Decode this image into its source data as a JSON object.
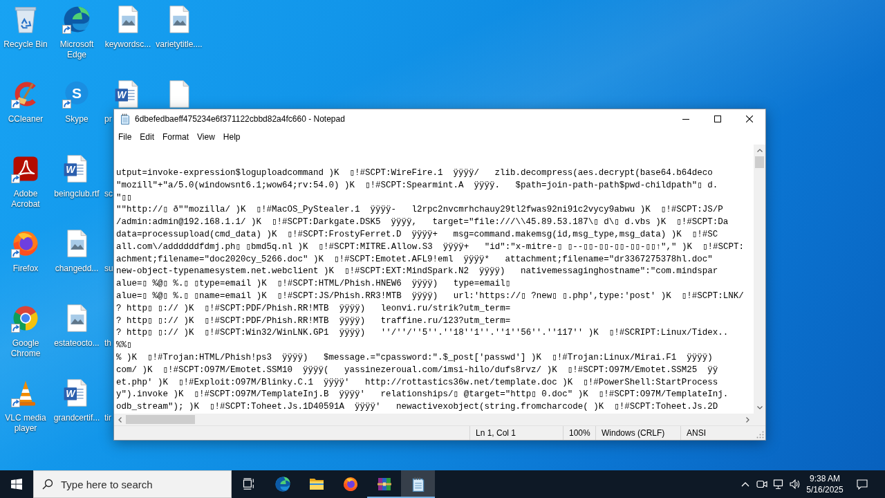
{
  "desktop": {
    "icons": [
      {
        "label": "Recycle Bin",
        "kind": "recycle-bin",
        "shortcut": false
      },
      {
        "label": "CCleaner",
        "kind": "ccleaner",
        "shortcut": true
      },
      {
        "label": "Adobe Acrobat",
        "kind": "acrobat",
        "shortcut": true
      },
      {
        "label": "Firefox",
        "kind": "firefox",
        "shortcut": true
      },
      {
        "label": "Google Chrome",
        "kind": "chrome",
        "shortcut": true
      },
      {
        "label": "VLC media player",
        "kind": "vlc",
        "shortcut": true
      },
      {
        "label": "Microsoft Edge",
        "kind": "edge",
        "shortcut": true
      },
      {
        "label": "Skype",
        "kind": "skype",
        "logo_text": "S",
        "shortcut": true
      },
      {
        "label": "beingclub.rtf",
        "kind": "word-doc",
        "logo_text": "W",
        "shortcut": false
      },
      {
        "label": "changedd...",
        "kind": "image-file",
        "shortcut": false
      },
      {
        "label": "estateocto...",
        "kind": "image-file",
        "shortcut": false
      },
      {
        "label": "grandcertif...",
        "kind": "word-doc",
        "logo_text": "W",
        "shortcut": false
      },
      {
        "label": "keywordsc...",
        "kind": "image-file",
        "shortcut": false
      },
      {
        "label": "pr",
        "kind": "word-doc",
        "logo_text": "W",
        "shortcut": false
      },
      {
        "label": "sc",
        "kind": "none",
        "shortcut": false
      },
      {
        "label": "su",
        "kind": "none",
        "shortcut": false
      },
      {
        "label": "th",
        "kind": "none",
        "shortcut": false
      },
      {
        "label": "tir",
        "kind": "none",
        "shortcut": false
      },
      {
        "label": "varietytitle....",
        "kind": "image-file",
        "shortcut": false
      },
      {
        "kind": "blank-file",
        "shortcut": false
      }
    ]
  },
  "notepad": {
    "title": "6dbefedbaeff475234e6f371122cbbd82a4fc660 - Notepad",
    "menu": [
      "File",
      "Edit",
      "Format",
      "View",
      "Help"
    ],
    "lines": [
      "utput=invoke-expression$loguploadcommand )K  ▯!#SCPT:WireFire.1  ÿÿÿÿ/   zlib.decompress(aes.decrypt(base64.b64deco",
      "\"mozill\"+\"a/5.0(windowsnt6.1;wow64;rv:54.0) )K  ▯!#SCPT:Spearmint.A  ÿÿÿÿ.   $path=join-path-path$pwd-childpath\"▯ d.",
      "\"▯▯",
      "\"\"http://▯ ð\"\"mozilla/ )K  ▯!#MacOS_PyStealer.1  ÿÿÿÿ-   l2rpc2nvcmrhchauy29tl2fwas92ni91c2vycy9abwu )K  ▯!#SCPT:JS/P",
      "/admin:admin@192.168.1.1/ )K  ▯!#SCPT:Darkgate.DSK5  ÿÿÿÿ,   target=\"file:///\\\\45.89.53.187\\▯ d\\▯ d.vbs )K  ▯!#SCPT:Da",
      "data=processupload(cmd_data) )K  ▯!#SCPT:FrostyFerret.D  ÿÿÿÿ+   msg=command.makemsg(id,msg_type,msg_data) )K  ▯!#SC",
      "all.com\\/addddddfdmj.ph▯ ▯bmd5q.nl )K  ▯!#SCPT:MITRE.Allow.S3  ÿÿÿÿ+   \"id\":\"x-mitre-▯ ▯--▯▯-▯▯-▯▯-▯▯-▯▯↑\",\" )K  ▯!#SCPT:",
      "achment;filename=\"doc2020cy_5266.doc\" )K  ▯!#SCPT:Emotet.AFL9!eml  ÿÿÿÿ*   attachment;filename=\"dr3367275378hl.doc\"",
      "new-object-typenamesystem.net.webclient )K  ▯!#SCPT:EXT:MindSpark.N2  ÿÿÿÿ)   nativemessaginghostname\":\"com.mindspar",
      "alue=▯ %@▯ %.▯ ▯type=email )K  ▯!#SCPT:HTML/Phish.HNEW6  ÿÿÿÿ)   type=email▯",
      "alue=▯ %@▯ %.▯ ▯name=email )K  ▯!#SCPT:JS/Phish.RR3!MTB  ÿÿÿÿ)   url:'https://▯ ?new▯ ▯.php',type:'post' )K  ▯!#SCPT:LNK/",
      "? http▯ ▯:// )K  ▯!#SCPT:PDF/Phish.RR!MTB  ÿÿÿÿ)   leonvi.ru/strik?utm_term=",
      "? http▯ ▯:// )K  ▯!#SCPT:PDF/Phish.RR!MTB  ÿÿÿÿ)   traffine.ru/123?utm_term=",
      "? http▯ ▯:// )K  ▯!#SCPT:Win32/WinLNK.GP1  ÿÿÿÿ)   ''/''/''5''.''18''1''.''1''56''.''117'' )K  ▯!#SCRIPT:Linux/Tidex..",
      "%%▯",
      "% )K  ▯!#Trojan:HTML/Phish!ps3  ÿÿÿÿ)   $message.=\"cpassword:\".$_post['passwd'] )K  ▯!#Trojan:Linux/Mirai.F1  ÿÿÿÿ)",
      "com/ )K  ▯!#SCPT:O97M/Emotet.SSM10  ÿÿÿÿ(   yassinezeroual.com/imsi-hilo/dufs8rvz/ )K  ▯!#SCPT:O97M/Emotet.SSM25  ÿÿ",
      "et.php' )K  ▯!#Exploit:O97M/Blinky.C.1  ÿÿÿÿ'   http://rottastics36w.net/template.doc )K  ▯!#PowerShell:StartProcess",
      "y\").invoke )K  ▯!#SCPT:O97M/TemplateInj.B  ÿÿÿÿ'   relationships/▯ @target=\"http▯ 0.doc\" )K  ▯!#SCPT:O97M/TemplateInj.",
      "odb_stream\"); )K  ▯!#SCPT:Toheet.Js.1D40591A  ÿÿÿÿ'   newactivexobject(string.fromcharcode( )K  ▯!#SCPT:Toheet.Js.2D"
    ],
    "status_bar": {
      "position": "Ln 1, Col 1",
      "zoom": "100%",
      "line_ending": "Windows (CRLF)",
      "encoding": "ANSI"
    }
  },
  "taskbar": {
    "search": {
      "placeholder": "Type here to search"
    },
    "buttons": [
      {
        "kind": "task-view",
        "running": false,
        "selected": false
      },
      {
        "kind": "edge",
        "running": false,
        "selected": false
      },
      {
        "kind": "file-explorer",
        "running": false,
        "selected": false
      },
      {
        "kind": "firefox",
        "running": false,
        "selected": false
      },
      {
        "kind": "winrar",
        "running": true,
        "selected": false
      },
      {
        "kind": "notepad",
        "running": true,
        "selected": true
      }
    ],
    "clock": {
      "time": "9:38 AM",
      "date": "5/16/2025"
    }
  }
}
